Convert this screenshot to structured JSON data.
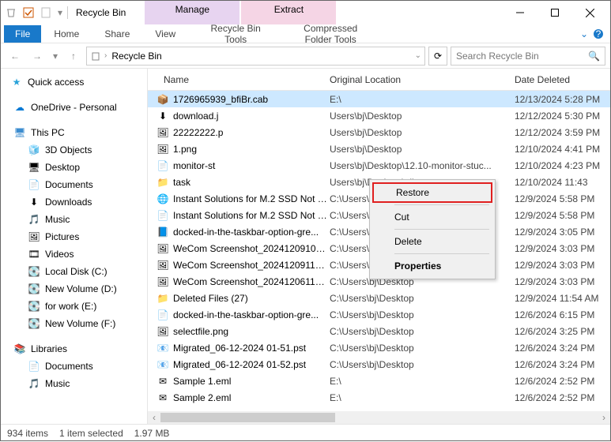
{
  "window": {
    "title": "Recycle Bin"
  },
  "titlebar_tabs": {
    "t1_top": "Manage",
    "t1_bottom": "Recycle Bin Tools",
    "t2_top": "Extract",
    "t2_bottom": "Compressed Folder Tools"
  },
  "ribbon": {
    "file": "File",
    "home": "Home",
    "share": "Share",
    "view": "View",
    "sub1": "Recycle Bin Tools",
    "sub2": "Compressed Folder Tools"
  },
  "address": {
    "crumb": "Recycle Bin"
  },
  "search": {
    "placeholder": "Search Recycle Bin"
  },
  "nav": {
    "quick": "Quick access",
    "onedrive": "OneDrive - Personal",
    "thispc": "This PC",
    "items": [
      "3D Objects",
      "Desktop",
      "Documents",
      "Downloads",
      "Music",
      "Pictures",
      "Videos",
      "Local Disk (C:)",
      "New Volume (D:)",
      "for work (E:)",
      "New Volume (F:)"
    ],
    "libraries": "Libraries",
    "lib_items": [
      "Documents",
      "Music"
    ]
  },
  "columns": {
    "name": "Name",
    "loc": "Original Location",
    "date": "Date Deleted"
  },
  "files": [
    {
      "ico": "cab",
      "name": "1726965939_bfiBr.cab",
      "loc": "E:\\",
      "date": "12/13/2024 5:28 PM",
      "sel": true
    },
    {
      "ico": "dl",
      "name": "download.j",
      "loc": "Users\\bj\\Desktop",
      "date": "12/12/2024 5:30 PM"
    },
    {
      "ico": "img",
      "name": "22222222.p",
      "loc": "Users\\bj\\Desktop",
      "date": "12/12/2024 3:59 PM"
    },
    {
      "ico": "img",
      "name": "1.png",
      "loc": "Users\\bj\\Desktop",
      "date": "12/10/2024 4:41 PM"
    },
    {
      "ico": "txt",
      "name": "monitor-st",
      "loc": "Users\\bj\\Desktop\\12.10-monitor-stuc...",
      "date": "12/10/2024 4:23 PM"
    },
    {
      "ico": "folder",
      "name": "task",
      "loc": "Users\\bj\\Desktop\\all",
      "date": "12/10/2024 11:43"
    },
    {
      "ico": "ie",
      "name": "Instant Solutions for M.2 SSD Not S...",
      "loc": "C:\\Users\\bj\\Desktop",
      "date": "12/9/2024 5:58 PM"
    },
    {
      "ico": "txt",
      "name": "Instant Solutions for M.2 SSD Not S...",
      "loc": "C:\\Users\\bj\\Desktop",
      "date": "12/9/2024 5:58 PM"
    },
    {
      "ico": "word",
      "name": "docked-in-the-taskbar-option-gre...",
      "loc": "C:\\Users\\bj\\Desktop",
      "date": "12/9/2024 3:05 PM"
    },
    {
      "ico": "img",
      "name": "WeCom Screenshot_202412091059...",
      "loc": "C:\\Users\\bj\\Desktop",
      "date": "12/9/2024 3:03 PM"
    },
    {
      "ico": "img",
      "name": "WeCom Screenshot_202412091100...",
      "loc": "C:\\Users\\bj\\Desktop",
      "date": "12/9/2024 3:03 PM"
    },
    {
      "ico": "img",
      "name": "WeCom Screenshot_202412061139...",
      "loc": "C:\\Users\\bj\\Desktop",
      "date": "12/9/2024 3:03 PM"
    },
    {
      "ico": "folder",
      "name": "Deleted Files (27)",
      "loc": "C:\\Users\\bj\\Desktop",
      "date": "12/9/2024 11:54 AM"
    },
    {
      "ico": "txt",
      "name": "docked-in-the-taskbar-option-gre...",
      "loc": "C:\\Users\\bj\\Desktop",
      "date": "12/6/2024 6:15 PM"
    },
    {
      "ico": "img",
      "name": "selectfile.png",
      "loc": "C:\\Users\\bj\\Desktop",
      "date": "12/6/2024 3:25 PM"
    },
    {
      "ico": "pst",
      "name": "Migrated_06-12-2024 01-51.pst",
      "loc": "C:\\Users\\bj\\Desktop",
      "date": "12/6/2024 3:24 PM"
    },
    {
      "ico": "pst",
      "name": "Migrated_06-12-2024 01-52.pst",
      "loc": "C:\\Users\\bj\\Desktop",
      "date": "12/6/2024 3:24 PM"
    },
    {
      "ico": "eml",
      "name": "Sample 1.eml",
      "loc": "E:\\",
      "date": "12/6/2024 2:52 PM"
    },
    {
      "ico": "eml",
      "name": "Sample 2.eml",
      "loc": "E:\\",
      "date": "12/6/2024 2:52 PM"
    }
  ],
  "context": {
    "restore": "Restore",
    "cut": "Cut",
    "delete": "Delete",
    "properties": "Properties"
  },
  "status": {
    "items": "934 items",
    "selected": "1 item selected",
    "size": "1.97 MB"
  },
  "icons": {
    "star": "gold",
    "onedrive": "#0078d4",
    "thispc": "#3b8ccf",
    "libs": "#0a6ebd"
  }
}
